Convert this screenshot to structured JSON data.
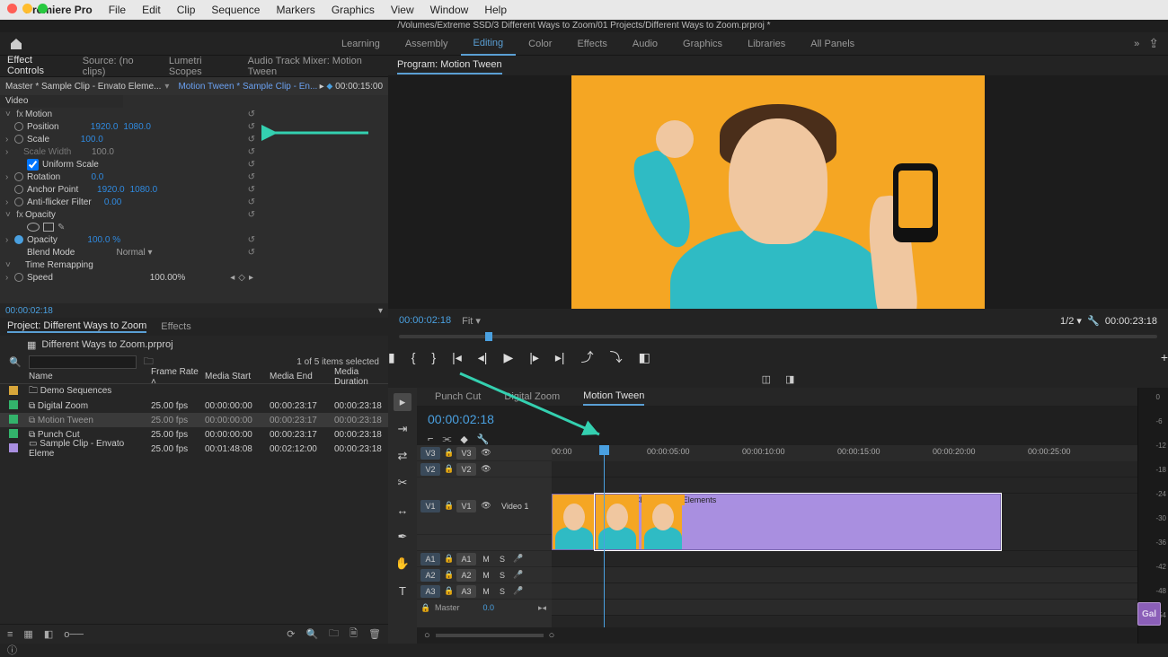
{
  "menu": {
    "app": "Premiere Pro",
    "items": [
      "File",
      "Edit",
      "Clip",
      "Sequence",
      "Markers",
      "Graphics",
      "View",
      "Window",
      "Help"
    ]
  },
  "title_path": "/Volumes/Extreme SSD/3 Different Ways to Zoom/01 Projects/Different Ways to Zoom.prproj *",
  "workspaces": [
    "Learning",
    "Assembly",
    "Editing",
    "Color",
    "Effects",
    "Audio",
    "Graphics",
    "Libraries",
    "All Panels"
  ],
  "workspace_active": "Editing",
  "source_tabs": [
    "Effect Controls",
    "Source: (no clips)",
    "Lumetri Scopes",
    "Audio Track Mixer: Motion Tween"
  ],
  "ec": {
    "master": "Master * Sample Clip - Envato Eleme...",
    "seq": "Motion Tween * Sample Clip - En...",
    "tc_end": "00:00:15:00",
    "clip_name": "Sample Clip - Envato Elements",
    "video_heading": "Video",
    "motion": "Motion",
    "position": "Position",
    "posX": "1920.0",
    "posY": "1080.0",
    "scale": "Scale",
    "scaleV": "100.0",
    "scale_w": "Scale Width",
    "scaleWV": "100.0",
    "uniform": "Uniform Scale",
    "rotation": "Rotation",
    "rotV": "0.0",
    "anchor": "Anchor Point",
    "anchorX": "1920.0",
    "anchorY": "1080.0",
    "flicker": "Anti-flicker Filter",
    "flickerV": "0.00",
    "opacity_section": "Opacity",
    "opacity": "Opacity",
    "opacityV": "100.0 %",
    "blend": "Blend Mode",
    "blendV": "Normal",
    "time": "Time Remapping",
    "speed": "Speed",
    "speedV": "100.00%",
    "footer_tc": "00:00:02:18"
  },
  "project": {
    "tab_project": "Project: Different Ways to Zoom",
    "tab_effects": "Effects",
    "path": "Different Ways to Zoom.prproj",
    "selected_info": "1 of 5 items selected",
    "headers": {
      "name": "Name",
      "fr": "Frame Rate",
      "ms": "Media Start",
      "me": "Media End",
      "md": "Media Duration"
    },
    "rows": [
      {
        "color": "#d8a63a",
        "type": "bin",
        "name": "Demo Sequences"
      },
      {
        "color": "#33b36b",
        "type": "seq",
        "name": "Digital Zoom",
        "fr": "25.00 fps",
        "ms": "00:00:00:00",
        "me": "00:00:23:17",
        "md": "00:00:23:18"
      },
      {
        "color": "#33b36b",
        "type": "seq",
        "name": "Motion Tween",
        "fr": "25.00 fps",
        "ms": "00:00:00:00",
        "me": "00:00:23:17",
        "md": "00:00:23:18",
        "selected": true
      },
      {
        "color": "#33b36b",
        "type": "seq",
        "name": "Punch Cut",
        "fr": "25.00 fps",
        "ms": "00:00:00:00",
        "me": "00:00:23:17",
        "md": "00:00:23:18"
      },
      {
        "color": "#a98fe0",
        "type": "clip",
        "name": "Sample Clip - Envato Eleme",
        "fr": "25.00 fps",
        "ms": "00:01:48:08",
        "me": "00:02:12:00",
        "md": "00:00:23:18"
      }
    ]
  },
  "program": {
    "tab": "Program: Motion Tween",
    "tc": "00:00:02:18",
    "fit": "Fit",
    "zoom": "1/2",
    "dur": "00:00:23:18"
  },
  "timeline": {
    "seq_tabs": [
      "Punch Cut",
      "Digital Zoom",
      "Motion Tween"
    ],
    "active_seq": "Motion Tween",
    "tc": "00:00:02:18",
    "ruler": [
      "00:00",
      "00:00:05:00",
      "00:00:10:00",
      "00:00:15:00",
      "00:00:20:00",
      "00:00:25:00"
    ],
    "video_tracks": [
      "V3",
      "V2",
      "V1"
    ],
    "audio_tracks": [
      "A1",
      "A2",
      "A3"
    ],
    "master": "Master",
    "master_db": "0.0",
    "v1_label": "Video 1",
    "clip1_name": "Sample",
    "clip2_name": "Sample Clip - Envato Elements",
    "meter_marks": [
      "0",
      "-6",
      "-12",
      "-18",
      "-24",
      "-30",
      "-36",
      "-42",
      "-48",
      "-54"
    ]
  },
  "colors": {
    "accent": "#5a9fd4",
    "value": "#2f8ae0",
    "clip": "#a98fe0",
    "viewer": "#f5a623"
  },
  "gal": "Gal"
}
